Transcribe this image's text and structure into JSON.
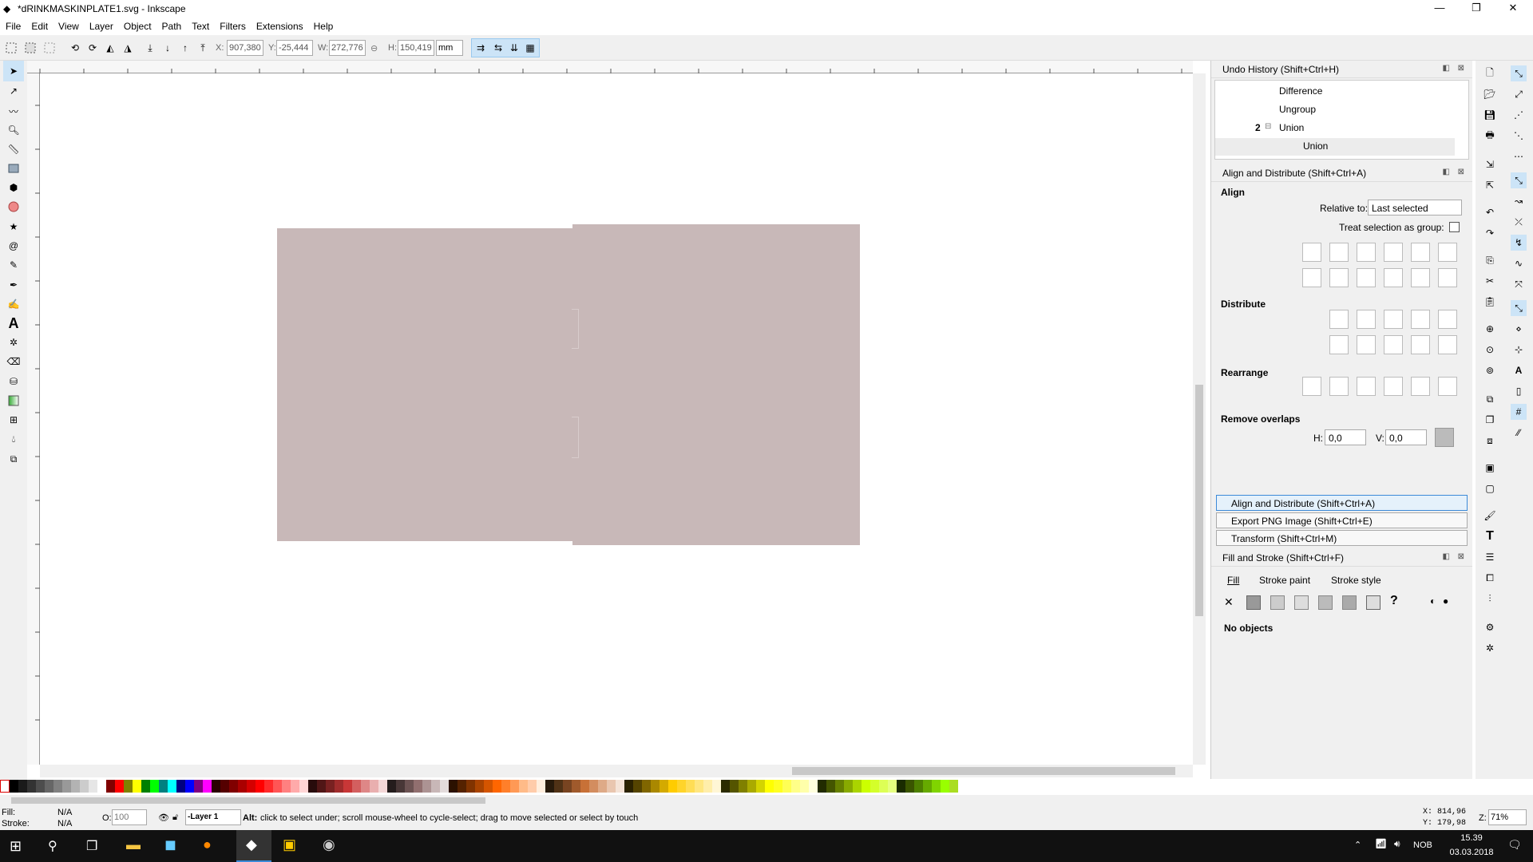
{
  "window": {
    "title": "*dRINKMASKINPLATE1.svg - Inkscape",
    "minimize": "—",
    "maximize": "❐",
    "close": "✕"
  },
  "menu": [
    "File",
    "Edit",
    "View",
    "Layer",
    "Object",
    "Path",
    "Text",
    "Filters",
    "Extensions",
    "Help"
  ],
  "toolbar": {
    "x_label": "X:",
    "x_value": "907,380",
    "y_label": "Y:",
    "y_value": "-25,444",
    "w_label": "W:",
    "w_value": "272,776",
    "h_label": "H:",
    "h_value": "150,419",
    "unit": "mm"
  },
  "undo_history": {
    "title": "Undo History (Shift+Ctrl+H)",
    "items": [
      {
        "label": "Difference",
        "count": ""
      },
      {
        "label": "Ungroup",
        "count": ""
      },
      {
        "label": "Union",
        "count": "2"
      },
      {
        "label": "Union",
        "count": ""
      }
    ]
  },
  "align": {
    "title": "Align and Distribute (Shift+Ctrl+A)",
    "align_heading": "Align",
    "relative_to_label": "Relative to:",
    "relative_to_value": "Last selected",
    "treat_group_label": "Treat selection as group:",
    "distribute_heading": "Distribute",
    "rearrange_heading": "Rearrange",
    "remove_overlaps_heading": "Remove overlaps",
    "h_label": "H:",
    "h_value": "0,0",
    "v_label": "V:",
    "v_value": "0,0"
  },
  "collapsed_panels": [
    "Align and Distribute (Shift+Ctrl+A)",
    "Export PNG Image (Shift+Ctrl+E)",
    "Transform (Shift+Ctrl+M)"
  ],
  "fill_stroke": {
    "title": "Fill and Stroke (Shift+Ctrl+F)",
    "tabs": [
      "Fill",
      "Stroke paint",
      "Stroke style"
    ],
    "no_objects": "No objects"
  },
  "status": {
    "fill_label": "Fill:",
    "fill_value": "N/A",
    "stroke_label": "Stroke:",
    "stroke_value": "N/A",
    "opacity_label": "O:",
    "opacity_value": "100",
    "layer": "-Layer 1",
    "message_bold": "Alt:",
    "message": " click to select under; scroll mouse-wheel to cycle-select; drag to move selected or select by touch",
    "x_coord": "X: 814,96",
    "y_coord": "Y: 179,98",
    "zoom_label": "Z:",
    "zoom_value": "71%"
  },
  "taskbar": {
    "lang": "NOB",
    "time": "15.39",
    "date": "03.03.2018"
  },
  "colors": {
    "shape": "#c8b8b8",
    "accent": "#3c8ad8"
  }
}
